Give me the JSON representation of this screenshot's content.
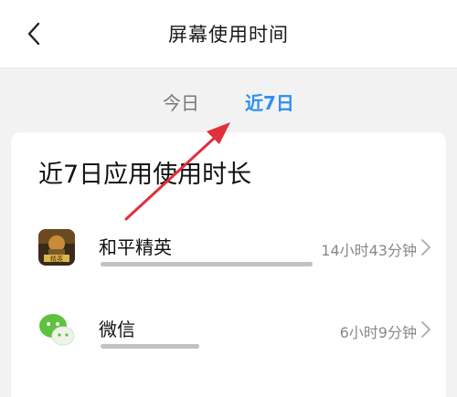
{
  "header": {
    "title": "屏幕使用时间",
    "back_icon": "chevron-left-icon"
  },
  "tabs": [
    {
      "label": "今日",
      "active": false
    },
    {
      "label": "近7日",
      "active": true
    }
  ],
  "card": {
    "title": "近7日应用使用时长",
    "apps": [
      {
        "name": "和平精英",
        "usage": "14小时43分钟",
        "icon": "game-icon",
        "usage_fraction": 1.0
      },
      {
        "name": "微信",
        "usage": "6小时9分钟",
        "icon": "wechat-icon",
        "usage_fraction": 0.42
      }
    ]
  },
  "colors": {
    "accent": "#2f8ff0",
    "annotation_arrow": "#e0303a"
  }
}
